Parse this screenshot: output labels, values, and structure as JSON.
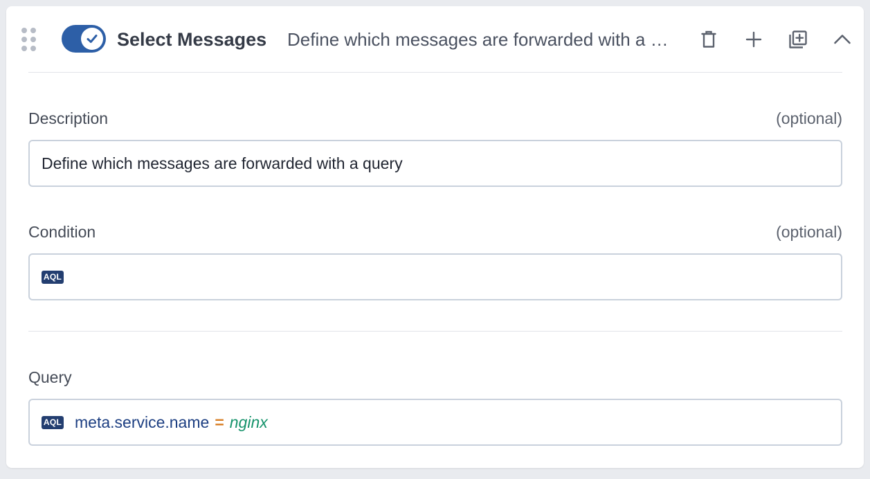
{
  "header": {
    "title": "Select Messages",
    "summary": "Define which messages are forwarded with a query",
    "enabled": true
  },
  "description": {
    "label": "Description",
    "optional": "(optional)",
    "value": "Define which messages are forwarded with a query"
  },
  "condition": {
    "label": "Condition",
    "optional": "(optional)",
    "badge": "AQL",
    "value": ""
  },
  "query": {
    "label": "Query",
    "badge": "AQL",
    "field": "meta.service.name",
    "operator": "=",
    "value": "nginx"
  },
  "colors": {
    "toggle": "#2d5fa7",
    "badge": "#233e70",
    "query_field": "#1d3f82",
    "query_operator": "#d9822b",
    "query_value": "#16936b"
  },
  "icons": [
    "drag-handle-icon",
    "check-icon",
    "trash-icon",
    "plus-icon",
    "duplicate-icon",
    "chevron-up-icon"
  ]
}
